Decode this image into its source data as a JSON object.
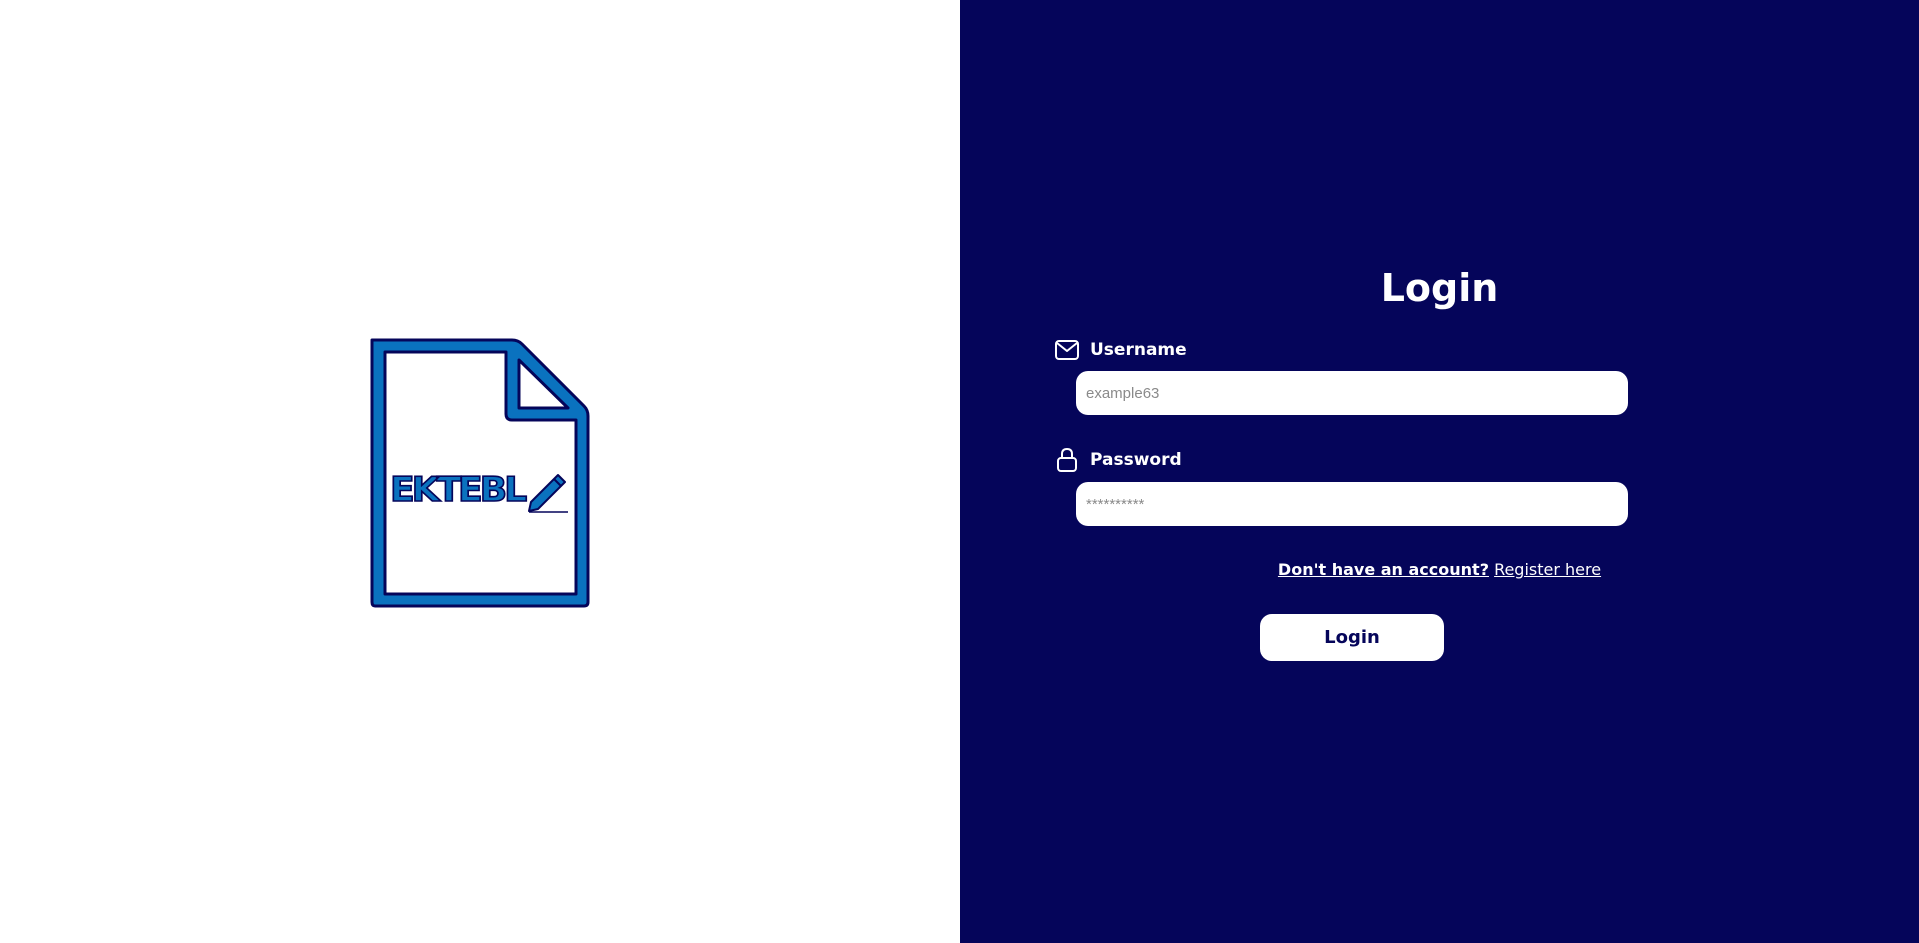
{
  "theme": {
    "left_bg": "#ffffff",
    "right_bg": "#05055a",
    "logo_fill": "#0a72bf",
    "logo_outline": "#05055a"
  },
  "logo": {
    "text": "EKTEBL",
    "icon": "pen-icon"
  },
  "login_form": {
    "title": "Login",
    "username": {
      "label": "Username",
      "icon": "envelope-icon",
      "placeholder": "example63",
      "value": ""
    },
    "password": {
      "label": "Password",
      "icon": "lock-icon",
      "placeholder": "**********",
      "value": ""
    },
    "register_prompt": "Don't have an account?",
    "register_link": "Register here",
    "submit_label": "Login"
  }
}
